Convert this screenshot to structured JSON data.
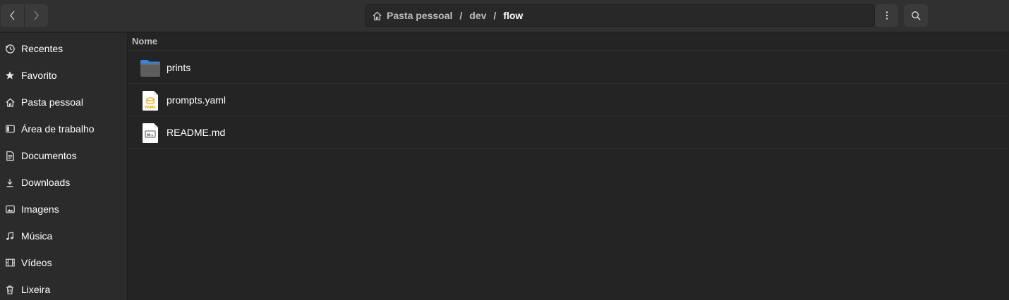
{
  "header": {
    "back_icon": "chevron-left-icon",
    "forward_icon": "chevron-right-icon",
    "path": {
      "home_icon": "home-icon",
      "crumbs": [
        "Pasta pessoal",
        "dev",
        "flow"
      ],
      "separator": "/"
    },
    "menu_icon": "vertical-dots-icon",
    "search_icon": "search-icon"
  },
  "sidebar": {
    "items": [
      {
        "label": "Recentes",
        "icon": "clock-icon"
      },
      {
        "label": "Favorito",
        "icon": "star-icon"
      },
      {
        "label": "Pasta pessoal",
        "icon": "home-icon"
      },
      {
        "label": "Área de trabalho",
        "icon": "desktop-icon"
      },
      {
        "label": "Documentos",
        "icon": "document-icon"
      },
      {
        "label": "Downloads",
        "icon": "download-icon"
      },
      {
        "label": "Imagens",
        "icon": "image-icon"
      },
      {
        "label": "Música",
        "icon": "music-icon"
      },
      {
        "label": "Vídeos",
        "icon": "video-icon"
      },
      {
        "label": "Lixeira",
        "icon": "trash-icon"
      }
    ]
  },
  "filelist": {
    "column_name": "Nome",
    "files": [
      {
        "name": "prints",
        "icon": "folder-icon"
      },
      {
        "name": "prompts.yaml",
        "icon": "yaml-file-icon",
        "badge": "YAML"
      },
      {
        "name": "README.md",
        "icon": "markdown-file-icon",
        "badge": "M↓"
      }
    ]
  },
  "colors": {
    "window_bg": "#242424",
    "headerbar_bg": "#303030",
    "sidebar_bg": "#2b2b2b",
    "folder_blue": "#3584e4",
    "yaml_orange": "#e5a50a"
  }
}
